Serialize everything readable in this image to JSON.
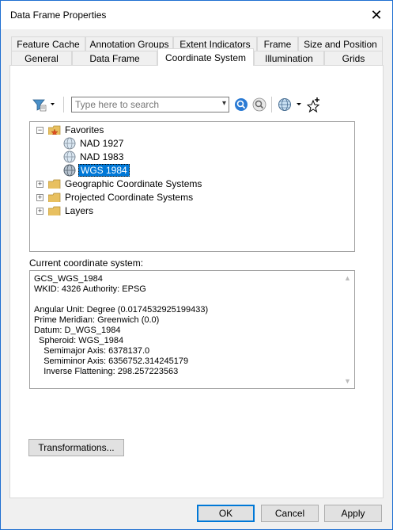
{
  "window": {
    "title": "Data Frame Properties"
  },
  "tabs_row1": [
    "Feature Cache",
    "Annotation Groups",
    "Extent Indicators",
    "Frame",
    "Size and Position"
  ],
  "tabs_row2": [
    "General",
    "Data Frame",
    "Coordinate System",
    "Illumination",
    "Grids"
  ],
  "active_tab": "Coordinate System",
  "search": {
    "placeholder": "Type here to search",
    "value": ""
  },
  "tree": {
    "favorites": {
      "label": "Favorites",
      "expanded": true,
      "items": [
        "NAD 1927",
        "NAD 1983",
        "WGS 1984"
      ],
      "selected": "WGS 1984"
    },
    "folders": [
      "Geographic Coordinate Systems",
      "Projected Coordinate Systems",
      "Layers"
    ]
  },
  "current_cs": {
    "label": "Current coordinate system:",
    "lines": [
      "GCS_WGS_1984",
      "WKID: 4326 Authority: EPSG",
      "",
      "Angular Unit: Degree (0.0174532925199433)",
      "Prime Meridian: Greenwich (0.0)",
      "Datum: D_WGS_1984",
      "  Spheroid: WGS_1984",
      "    Semimajor Axis: 6378137.0",
      "    Semiminor Axis: 6356752.314245179",
      "    Inverse Flattening: 298.257223563"
    ]
  },
  "buttons": {
    "transformations": "Transformations...",
    "ok": "OK",
    "cancel": "Cancel",
    "apply": "Apply"
  },
  "colors": {
    "selection": "#0078d7",
    "default_button_border": "#0078d7",
    "folder": "#e8c060"
  }
}
